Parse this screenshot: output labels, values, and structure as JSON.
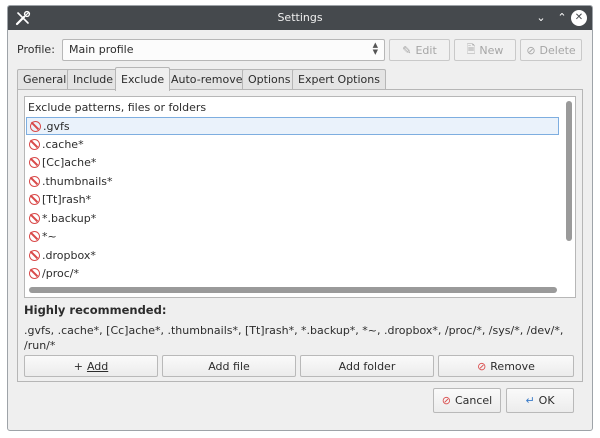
{
  "window": {
    "title": "Settings"
  },
  "profile": {
    "label": "Profile:",
    "selected": "Main profile",
    "edit_label": "Edit",
    "new_label": "New",
    "delete_label": "Delete"
  },
  "tabs": [
    {
      "label": "General"
    },
    {
      "label": "Include"
    },
    {
      "label": "Exclude"
    },
    {
      "label": "Auto-remove"
    },
    {
      "label": "Options"
    },
    {
      "label": "Expert Options"
    }
  ],
  "exclude": {
    "header": "Exclude patterns, files or folders",
    "items": [
      ".gvfs",
      ".cache*",
      "[Cc]ache*",
      ".thumbnails*",
      "[Tt]rash*",
      "*.backup*",
      "*~",
      ".dropbox*",
      "/proc/*"
    ],
    "recommended_title": "Highly recommended:",
    "recommended_text": ".gvfs, .cache*, [Cc]ache*, .thumbnails*, [Tt]rash*, *.backup*, *~, .dropbox*, /proc/*, /sys/*, /dev/*, /run/*",
    "add_label": "Add",
    "add_file_label": "Add file",
    "add_folder_label": "Add folder",
    "remove_label": "Remove"
  },
  "footer": {
    "cancel_label": "Cancel",
    "ok_label": "OK"
  }
}
